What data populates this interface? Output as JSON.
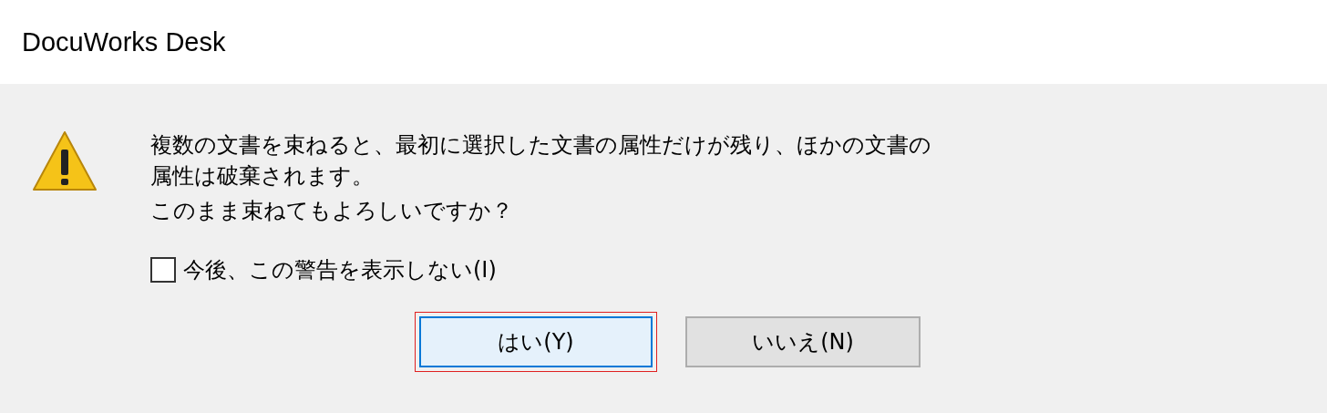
{
  "window": {
    "title": "DocuWorks Desk"
  },
  "message_lines": [
    "複数の文書を束ねると、最初に選択した文書の属性だけが残り、ほかの文書の",
    "属性は破棄されます。",
    "このまま束ねてもよろしいですか？"
  ],
  "checkbox": {
    "label": "今後、この警告を表示しない(I)",
    "checked": false
  },
  "buttons": [
    {
      "label": "はい(Y)",
      "selected": true,
      "highlighted": true
    },
    {
      "label": "いいえ(N)",
      "selected": false,
      "highlighted": false
    }
  ]
}
